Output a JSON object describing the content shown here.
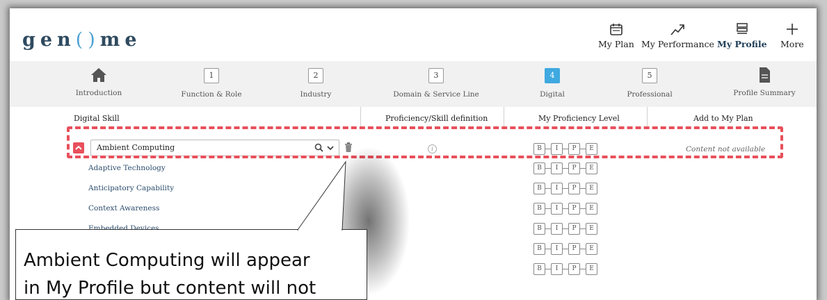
{
  "app": {
    "logo_text": "gen",
    "logo_o": "()",
    "logo_tail": "me"
  },
  "header_nav": [
    {
      "label": "My Plan",
      "icon": "calendar-icon"
    },
    {
      "label": "My Performance",
      "icon": "trend-up-icon"
    },
    {
      "label": "My Profile",
      "icon": "profile-list-icon",
      "active": true
    },
    {
      "label": "More",
      "icon": "plus-icon"
    }
  ],
  "steps": [
    {
      "label": "Introduction",
      "icon": "home-icon"
    },
    {
      "num": "1",
      "label": "Function & Role"
    },
    {
      "num": "2",
      "label": "Industry"
    },
    {
      "num": "3",
      "label": "Domain & Service Line"
    },
    {
      "num": "4",
      "label": "Digital",
      "active": true
    },
    {
      "num": "5",
      "label": "Professional"
    },
    {
      "label": "Profile Summary",
      "icon": "document-icon"
    }
  ],
  "table": {
    "headers": [
      "Digital Skill",
      "Proficiency/Skill definition",
      "My Proficiency Level",
      "Add to My Plan"
    ],
    "selected_skill": "Ambient Computing",
    "content_status": "Content not available",
    "info_glyph": "i",
    "sub_skills": [
      "Adaptive Technology",
      "Anticipatory Capability",
      "Context Awareness",
      "Embedded Devices"
    ],
    "levels": [
      "B",
      "I",
      "P",
      "E"
    ]
  },
  "callout": {
    "line1": "Ambient Computing will appear",
    "line2": "in My Profile but content will not"
  },
  "colors": {
    "accent": "#3fa9e0",
    "highlight": "#e8505b",
    "brand": "#2f4a5f"
  }
}
